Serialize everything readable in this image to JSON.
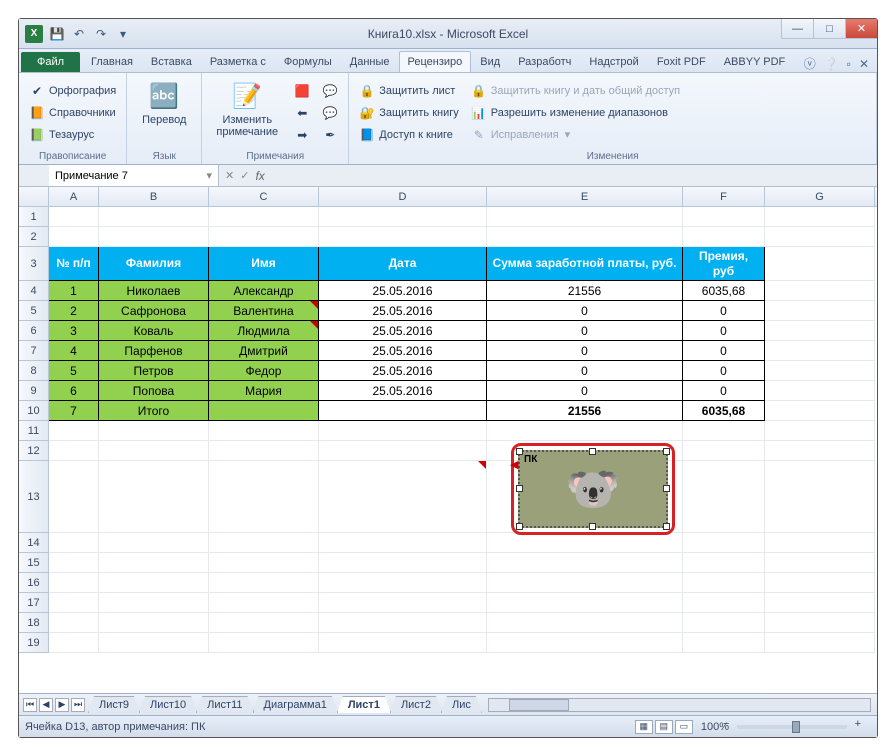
{
  "window": {
    "title": "Книга10.xlsx - Microsoft Excel"
  },
  "qat": {
    "save_tip": "Сохранить",
    "undo_tip": "↶",
    "redo_tip": "↷"
  },
  "tabs": {
    "file": "Файл",
    "items": [
      "Главная",
      "Вставка",
      "Разметка с",
      "Формулы",
      "Данные",
      "Рецензиро",
      "Вид",
      "Разработч",
      "Надстрой",
      "Foxit PDF",
      "ABBYY PDF"
    ],
    "active_index": 5
  },
  "ribbon": {
    "proofing": {
      "label": "Правописание",
      "spelling": "Орфография",
      "reference": "Справочники",
      "thesaurus": "Тезаурус"
    },
    "language": {
      "label": "Язык",
      "translate": "Перевод"
    },
    "comments": {
      "label": "Примечания",
      "edit": "Изменить примечание"
    },
    "changes": {
      "label": "Изменения",
      "protect_sheet": "Защитить лист",
      "protect_book": "Защитить книгу",
      "share_book": "Доступ к книге",
      "protect_share": "Защитить книгу и дать общий доступ",
      "allow_ranges": "Разрешить изменение диапазонов",
      "track": "Исправления"
    }
  },
  "formula_bar": {
    "name": "Примечание 7",
    "fx": "fx",
    "value": ""
  },
  "columns": [
    "A",
    "B",
    "C",
    "D",
    "E",
    "F",
    "G"
  ],
  "row_numbers": [
    1,
    2,
    3,
    4,
    5,
    6,
    7,
    8,
    9,
    10,
    11,
    12,
    13,
    14,
    15,
    16,
    17,
    18,
    19
  ],
  "table": {
    "headers": [
      "№ п/п",
      "Фамилия",
      "Имя",
      "Дата",
      "Сумма заработной платы, руб.",
      "Премия, руб"
    ],
    "rows": [
      [
        "1",
        "Николаев",
        "Александр",
        "25.05.2016",
        "21556",
        "6035,68"
      ],
      [
        "2",
        "Сафронова",
        "Валентина",
        "25.05.2016",
        "0",
        "0"
      ],
      [
        "3",
        "Коваль",
        "Людмила",
        "25.05.2016",
        "0",
        "0"
      ],
      [
        "4",
        "Парфенов",
        "Дмитрий",
        "25.05.2016",
        "0",
        "0"
      ],
      [
        "5",
        "Петров",
        "Федор",
        "25.05.2016",
        "0",
        "0"
      ],
      [
        "6",
        "Попова",
        "Мария",
        "25.05.2016",
        "0",
        "0"
      ],
      [
        "7",
        "Итого",
        "",
        "",
        "21556",
        "6035,68"
      ]
    ]
  },
  "comment": {
    "author": "ПК"
  },
  "sheets": {
    "items": [
      "Лист9",
      "Лист10",
      "Лист11",
      "Диаграмма1",
      "Лист1",
      "Лист2",
      "Лис"
    ],
    "active_index": 4
  },
  "status": {
    "cell_info": "Ячейка D13, автор примечания: ПК",
    "zoom": "100%"
  }
}
